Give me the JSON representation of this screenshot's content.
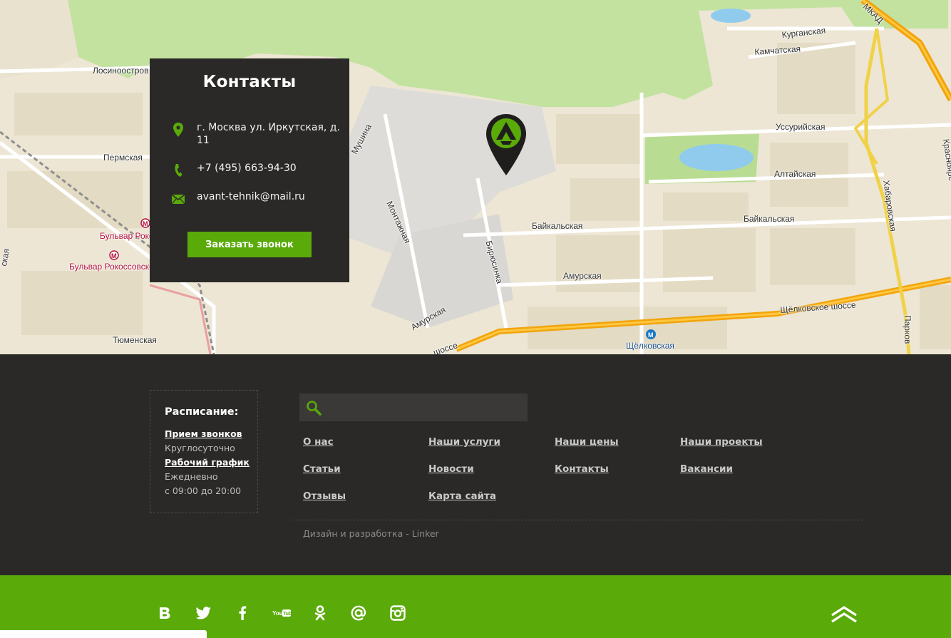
{
  "map": {
    "labels": {
      "losinoostrov": "Лосиноостров",
      "permskaya": "Пермская",
      "metro_bulvar_1": "Бульвар Рокос",
      "metro_bulvar_2": "Бульвар Рокоссовско",
      "tyumenskaya": "Тюменская",
      "mushina": "Мушина",
      "montazhnaya": "Монтажная",
      "birosinka": "Бирюсинка",
      "amurskaya_left": "Амурская",
      "baykalskaya_1": "Байкальская",
      "amurskaya": "Амурская",
      "kurganskaya": "Курганская",
      "kamchatskaya": "Камчатская",
      "ussuriyskaya": "Уссурийская",
      "altayskaya": "Алтайская",
      "baykalskaya_2": "Байкальская",
      "shchelkovskoe": "Щёлковское шоссе",
      "shosse_left": "шоссе",
      "metro_shchelkovskaya": "Щёлковская",
      "mkad": "МКАД",
      "khabarovskaya": "Хабаровская",
      "krasnoyarskaya": "Красноярс",
      "parkovaya": "Парков",
      "left_edge": "ская"
    }
  },
  "contacts": {
    "title": "Контакты",
    "address": "г. Москва ул. Иркутская, д. 11",
    "phone": "+7 (495) 663-94-30",
    "email": "avant-tehnik@mail.ru",
    "call_button": "Заказать звонок",
    "accent_color": "#5aaa0a"
  },
  "footer": {
    "schedule": {
      "title": "Расписание:",
      "calls_head": "Прием звонков",
      "calls_text": "Круглосуточно",
      "work_head": "Рабочий график",
      "work_text_1": "Ежедневно",
      "work_text_2": "с 09:00 до 20:00"
    },
    "search": {
      "placeholder": ""
    },
    "nav": {
      "about": "О нас",
      "services": "Наши услуги",
      "prices": "Наши цены",
      "projects": "Наши проекты",
      "articles": "Статьи",
      "news": "Новости",
      "contacts": "Контакты",
      "vacancies": "Вакансии",
      "reviews": "Отзывы",
      "sitemap": "Карта сайта"
    },
    "credit": "Дизайн и разработка - Linker"
  },
  "social": {
    "icons": [
      "vk-icon",
      "twitter-icon",
      "facebook-icon",
      "youtube-icon",
      "odnoklassniki-icon",
      "mailru-icon",
      "instagram-icon"
    ],
    "youtube_text": "You Tube"
  }
}
